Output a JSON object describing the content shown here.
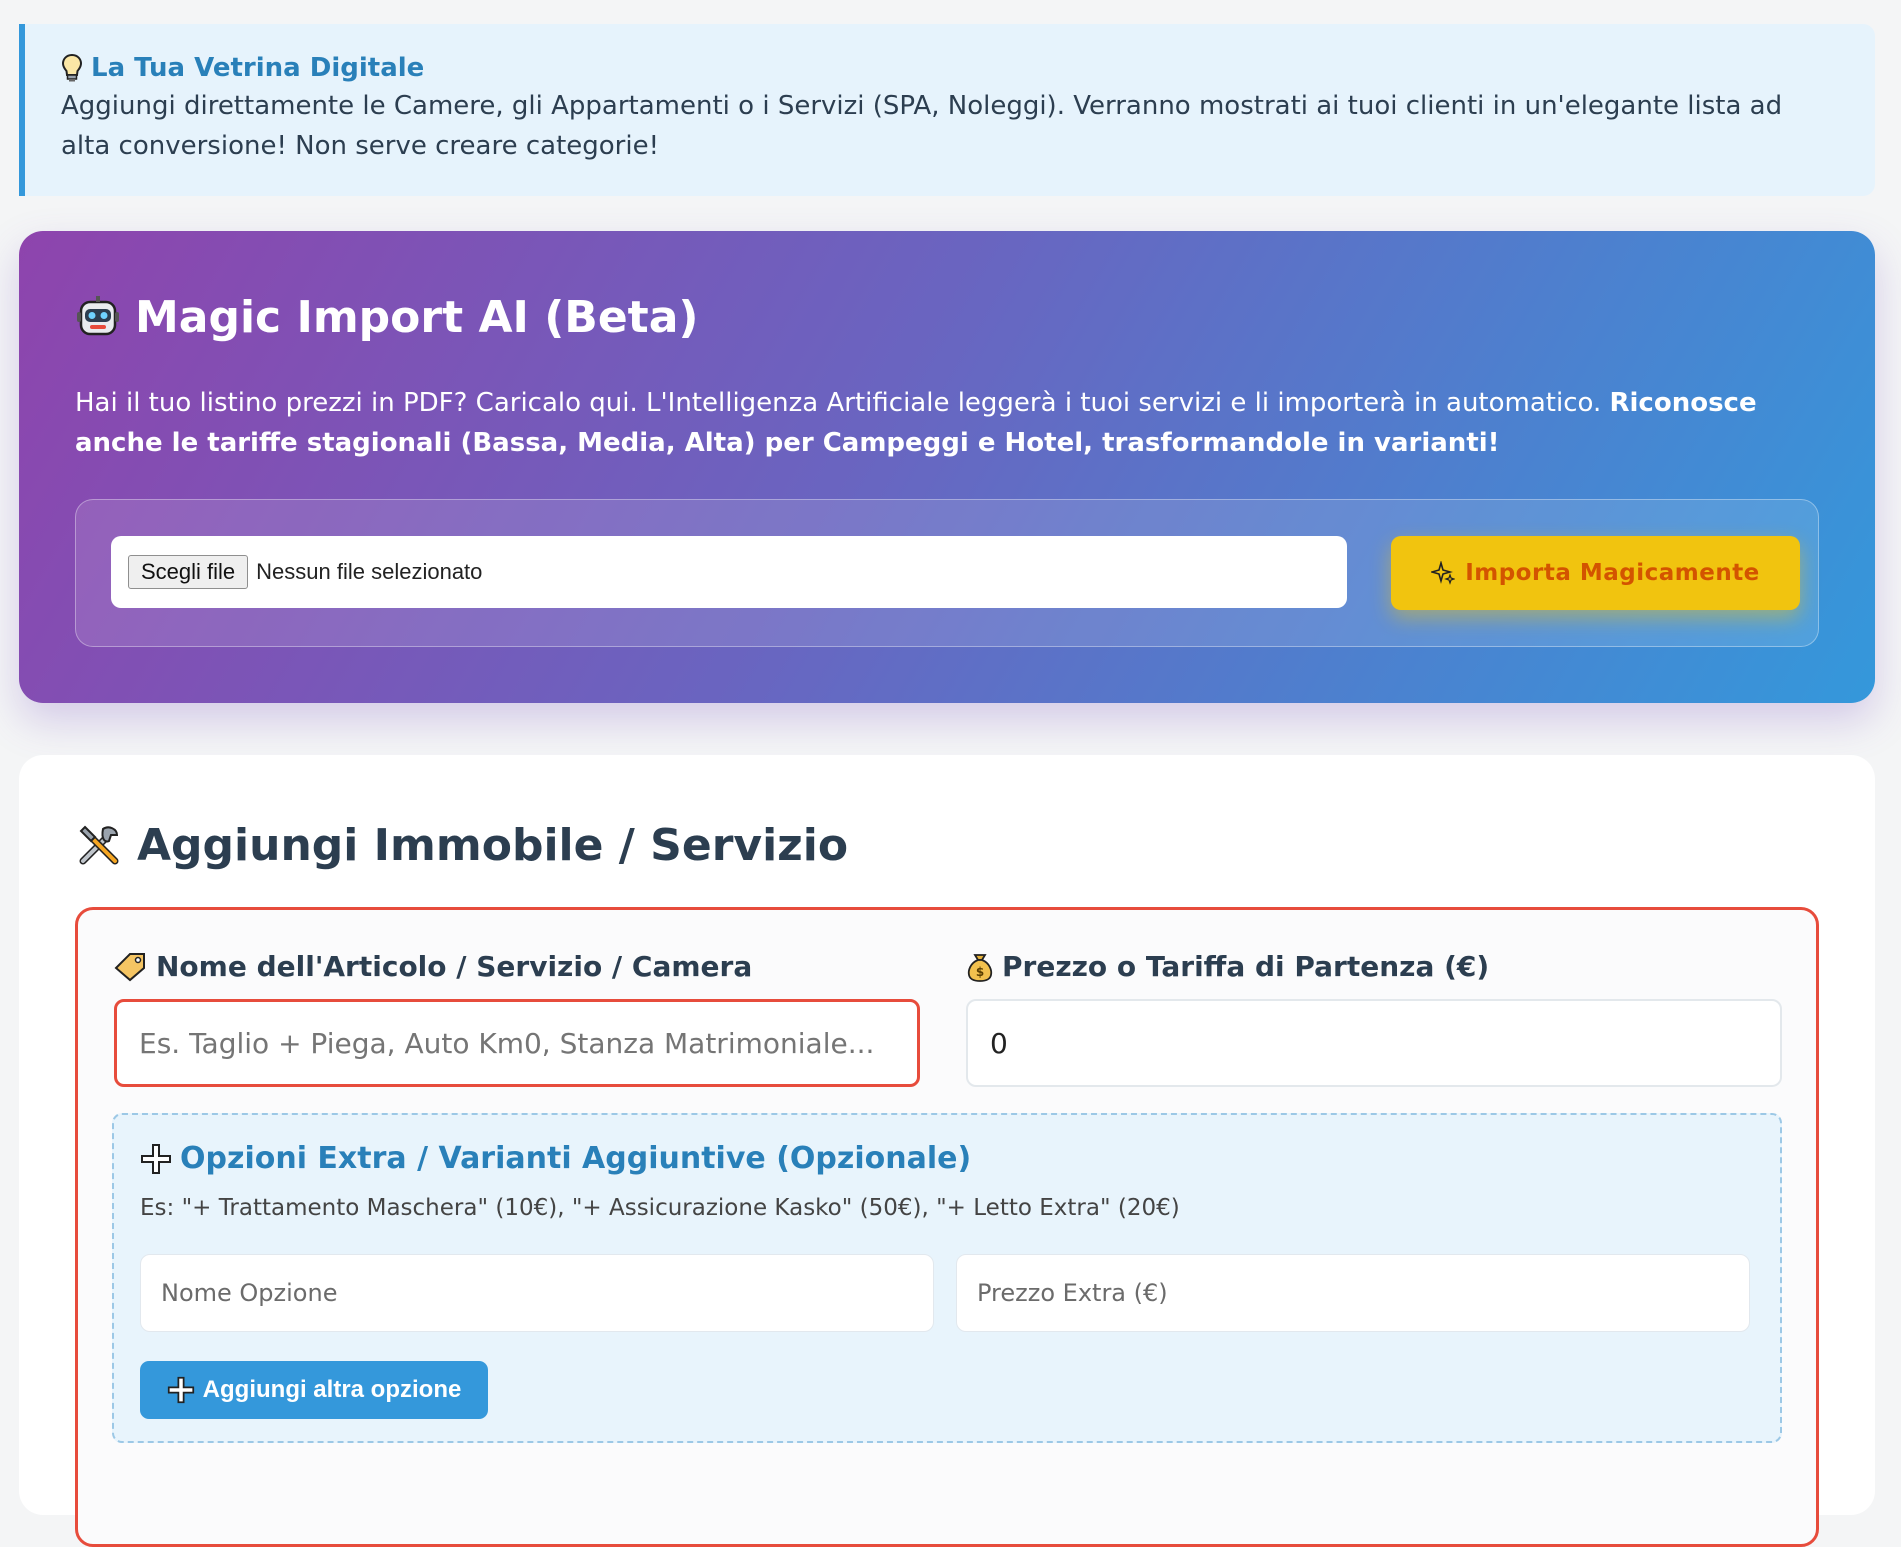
{
  "tip": {
    "icon": "lightbulb-icon",
    "title": "La Tua Vetrina Digitale",
    "text": "Aggiungi direttamente le Camere, gli Appartamenti o i Servizi (SPA, Noleggi). Verranno mostrati ai tuoi clienti in un'elegante lista ad alta conversione! Non serve creare categorie!"
  },
  "magic_import": {
    "icon": "robot-icon",
    "title": "Magic Import AI (Beta)",
    "description": "Hai il tuo listino prezzi in PDF? Caricalo qui. L'Intelligenza Artificiale leggerà i tuoi servizi e li importerà in automatico. ",
    "description_bold": "Riconosce anche le tariffe stagionali (Bassa, Media, Alta) per Campeggi e Hotel, trasformandole in varianti!",
    "file_button": "Scegli file",
    "file_status": "Nessun file selezionato",
    "import_button": "Importa Magicamente",
    "colors": {
      "gradient_start": "#8e44ad",
      "gradient_end": "#3498db",
      "button": "#f1c40f",
      "button_text": "#d35400"
    }
  },
  "form": {
    "icon": "tools-icon",
    "title": "Aggiungi Immobile / Servizio",
    "name_label": "Nome dell'Articolo / Servizio / Camera",
    "name_placeholder": "Es. Taglio + Piega, Auto Km0, Stanza Matrimoniale...",
    "price_label": "Prezzo o Tariffa di Partenza (€)",
    "price_value": "0",
    "options": {
      "title": "Opzioni Extra / Varianti Aggiuntive (Opzionale)",
      "hint": "Es: \"+ Trattamento Maschera\" (10€), \"+ Assicurazione Kasko\" (50€), \"+ Letto Extra\" (20€)",
      "name_placeholder": "Nome Opzione",
      "price_placeholder": "Prezzo Extra (€)",
      "add_button": "Aggiungi altra opzione"
    },
    "colors": {
      "error_border": "#e74c3c",
      "accent": "#3498db"
    }
  }
}
